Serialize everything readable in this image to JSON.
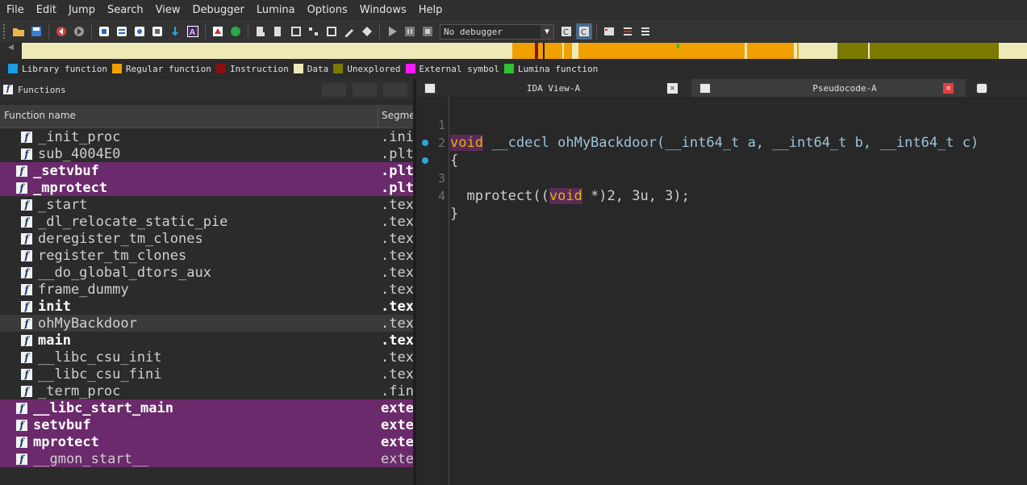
{
  "menu": [
    "File",
    "Edit",
    "Jump",
    "Search",
    "View",
    "Debugger",
    "Lumina",
    "Options",
    "Windows",
    "Help"
  ],
  "toolbar": {
    "debugger_select": "No debugger"
  },
  "legend": [
    {
      "label": "Library function",
      "color": "#1a9be6"
    },
    {
      "label": "Regular function",
      "color": "#f0a000"
    },
    {
      "label": "Instruction",
      "color": "#8a1010"
    },
    {
      "label": "Data",
      "color": "#eeeab8"
    },
    {
      "label": "Unexplored",
      "color": "#7a7a00"
    },
    {
      "label": "External symbol",
      "color": "#ff1aff"
    },
    {
      "label": "Lumina function",
      "color": "#30c030"
    }
  ],
  "functions_panel": {
    "title": "Functions",
    "columns": [
      "Function name",
      "Segme"
    ],
    "rows": [
      {
        "name": "_init_proc",
        "segment": ".ini",
        "style": "lib"
      },
      {
        "name": "sub_4004E0",
        "segment": ".plt",
        "style": "lib"
      },
      {
        "name": "_setvbuf",
        "segment": ".plt",
        "style": "extern"
      },
      {
        "name": "_mprotect",
        "segment": ".plt",
        "style": "extern"
      },
      {
        "name": "_start",
        "segment": ".tex",
        "style": "lib"
      },
      {
        "name": "_dl_relocate_static_pie",
        "segment": ".tex",
        "style": "lib"
      },
      {
        "name": "deregister_tm_clones",
        "segment": ".tex",
        "style": "lib"
      },
      {
        "name": "register_tm_clones",
        "segment": ".tex",
        "style": "lib"
      },
      {
        "name": "__do_global_dtors_aux",
        "segment": ".tex",
        "style": "lib"
      },
      {
        "name": "frame_dummy",
        "segment": ".tex",
        "style": "lib"
      },
      {
        "name": "init",
        "segment": ".tex",
        "style": "bold"
      },
      {
        "name": "ohMyBackdoor",
        "segment": ".tex",
        "style": "selected"
      },
      {
        "name": "main",
        "segment": ".tex",
        "style": "bold"
      },
      {
        "name": "__libc_csu_init",
        "segment": ".tex",
        "style": "lib"
      },
      {
        "name": "__libc_csu_fini",
        "segment": ".tex",
        "style": "lib"
      },
      {
        "name": "_term_proc",
        "segment": ".fin",
        "style": "lib"
      },
      {
        "name": "__libc_start_main",
        "segment": "exte",
        "style": "extern"
      },
      {
        "name": "setvbuf",
        "segment": "exte",
        "style": "extern"
      },
      {
        "name": "mprotect",
        "segment": "exte",
        "style": "extern"
      },
      {
        "name": "__gmon_start__",
        "segment": "exte",
        "style": "extern-lib"
      }
    ]
  },
  "tabs": [
    {
      "label": "IDA View-A"
    },
    {
      "label": "Pseudocode-A"
    }
  ],
  "pseudocode": {
    "line_numbers": [
      "1",
      "2",
      "3",
      "4"
    ],
    "l1_void": "void",
    "l1_cc": "__cdecl",
    "l1_fn": "ohMyBackdoor",
    "l1_open": "(",
    "l1_t1": "__int64_t",
    "l1_a": "a,",
    "l1_t2": "__int64_t",
    "l1_b": "b,",
    "l1_t3": "__int64_t",
    "l1_c": "c)",
    "l2": "{",
    "l3_call": "mprotect((",
    "l3_void": "void",
    "l3_rest": " *)2, 3u, 3);",
    "l4": "}"
  }
}
